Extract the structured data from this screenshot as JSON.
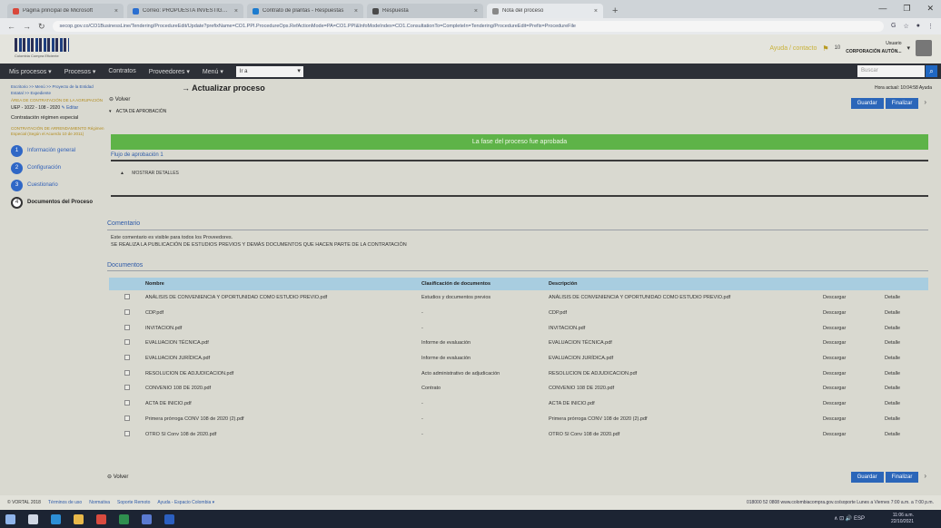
{
  "browser": {
    "tabs": [
      {
        "title": "Página principal de Microsoft",
        "color": "#d9473a",
        "active": false
      },
      {
        "title": "Correo: PROPUESTA INVESTIGACIÓN",
        "color": "#2b6fd1",
        "active": false
      },
      {
        "title": "Contrato de plantas - Respuestas",
        "color": "#1d7ccf",
        "active": false
      },
      {
        "title": "Respuesta",
        "color": "#4a4a4a",
        "active": false
      },
      {
        "title": "Nota del proceso",
        "color": "#888888",
        "active": true
      }
    ],
    "url": "secop.gov.co/CO1BusinessLine/Tendering/ProcedureEdit/Update?prefixName=CO1.PPI.ProcedureOps.RefActionMode=PA=CO1.PPI&InfoModeIndex=CO1.ConsultationTo=CompleteIn=Tendering/ProcedureEdit=Prefix=ProcedureFile",
    "window_controls": [
      "—",
      "❐",
      "✕"
    ]
  },
  "header": {
    "logo_caption": "Colombia Compra Eficiente",
    "user_link": "Ayuda / contacto",
    "notif_count": "10",
    "user_role": "Usuario",
    "user_org": "CORPORACIÓN AUTÓN..."
  },
  "menu": {
    "items": [
      "Mis procesos ▾",
      "Procesos ▾",
      "Contratos",
      "Proveedores ▾",
      "Menú ▾"
    ],
    "select_value": "Ir a",
    "search_placeholder": "Buscar"
  },
  "sidebar": {
    "breadcrumb": "Escritorio >> Menú >> Proyecto de la Entidad Estatal >> Expediente",
    "org": "ÁREA DE CONTRATACIÓN DE LA AGRUPACIÓN",
    "process_id": "UEP - 1022 - 108 - 2020",
    "edit_label": "Editar",
    "title": "Contratación régimen especial",
    "type": "CONTRATACIÓN DE ARRENDAMIENTO Régimen Especial (Según el Acuerdo 10 de 2011)",
    "steps": [
      {
        "num": "1",
        "label": "Información general",
        "current": false
      },
      {
        "num": "2",
        "label": "Configuración",
        "current": false
      },
      {
        "num": "3",
        "label": "Cuestionario",
        "current": false
      },
      {
        "num": "4",
        "label": "Documentos del Proceso",
        "current": true
      }
    ]
  },
  "main": {
    "page_title": "→ Actualizar proceso",
    "back_label": "Volver",
    "acta_label": "ACTA DE APROBACIÓN",
    "time_info": "Hora actual: 10:04:58 Ayuda",
    "save_label": "Guardar",
    "finish_label": "Finalizar",
    "status_message": "La fase del proceso fue aprobada",
    "flow_label": "Flujo de aprobación 1",
    "details_label": "MOSTRAR DETALLES",
    "comment_heading": "Comentario",
    "comment_note": "Este comentario es visible para todos los Proveedores.",
    "comment_text": "SE REALIZA LA PUBLICACIÓN DE ESTUDIOS PREVIOS Y DEMÁS DOCUMENTOS QUE HACEN PARTE DE LA CONTRATACIÓN",
    "documents_heading": "Documentos"
  },
  "documents": {
    "headers": [
      "Nombre",
      "Clasificación de documentos",
      "Descripción"
    ],
    "download_label": "Descargar",
    "detail_label": "Detalle",
    "rows": [
      {
        "name": "ANÁLISIS DE CONVENIENCIA Y OPORTUNIDAD COMO ESTUDIO PREVIO.pdf",
        "class": "Estudios y documentos previos",
        "desc": "ANÁLISIS DE CONVENIENCIA Y OPORTUNIDAD COMO ESTUDIO PREVIO.pdf"
      },
      {
        "name": "CDP.pdf",
        "class": "-",
        "desc": "CDP.pdf"
      },
      {
        "name": "INVITACION.pdf",
        "class": "-",
        "desc": "INVITACION.pdf"
      },
      {
        "name": "EVALUACION TÉCNICA.pdf",
        "class": "Informe de evaluación",
        "desc": "EVALUACION TÉCNICA.pdf"
      },
      {
        "name": "EVALUACION JURÍDICA.pdf",
        "class": "Informe de evaluación",
        "desc": "EVALUACION JURÍDICA.pdf"
      },
      {
        "name": "RESOLUCION DE ADJUDICACION.pdf",
        "class": "Acto administrativo de adjudicación",
        "desc": "RESOLUCION DE ADJUDICACION.pdf"
      },
      {
        "name": "CONVENIO 108 DE 2020.pdf",
        "class": "Contrato",
        "desc": "CONVENIO 108 DE 2020.pdf"
      },
      {
        "name": "ACTA DE INICIO.pdf",
        "class": "-",
        "desc": "ACTA DE INICIO.pdf"
      },
      {
        "name": "Primera prórroga CONV 108 de 2020 (2).pdf",
        "class": "-",
        "desc": "Primera prórroga CONV 108 de 2020 (2).pdf"
      },
      {
        "name": "OTRO SI Conv 108 de 2020.pdf",
        "class": "-",
        "desc": "OTRO SI Conv 108 de 2020.pdf"
      }
    ]
  },
  "footer": {
    "links": [
      "© VORTAL 2018",
      "Términos de uso",
      "Normativa",
      "Soporte Remoto",
      "Ayuda - Espacio Colombia ▾"
    ],
    "contact": "018000 52 0808  www.colombiacompra.gov.co/soporte  Lunes a Viernes 7:00 a.m. a 7:00 p.m."
  },
  "taskbar": {
    "icons": [
      "windows",
      "search",
      "edge",
      "explorer",
      "chrome",
      "excel",
      "store",
      "word"
    ],
    "icon_colors": [
      "#8fb4ea",
      "#cfd6e3",
      "#2d8fd6",
      "#e8b84a",
      "#d94b3f",
      "#2f8f4f",
      "#5a7ad0",
      "#2b5fc0"
    ],
    "tray": "∧ ⊡ 🔊 ESP",
    "time": "11:06 a.m.",
    "date": "22/10/2021"
  }
}
